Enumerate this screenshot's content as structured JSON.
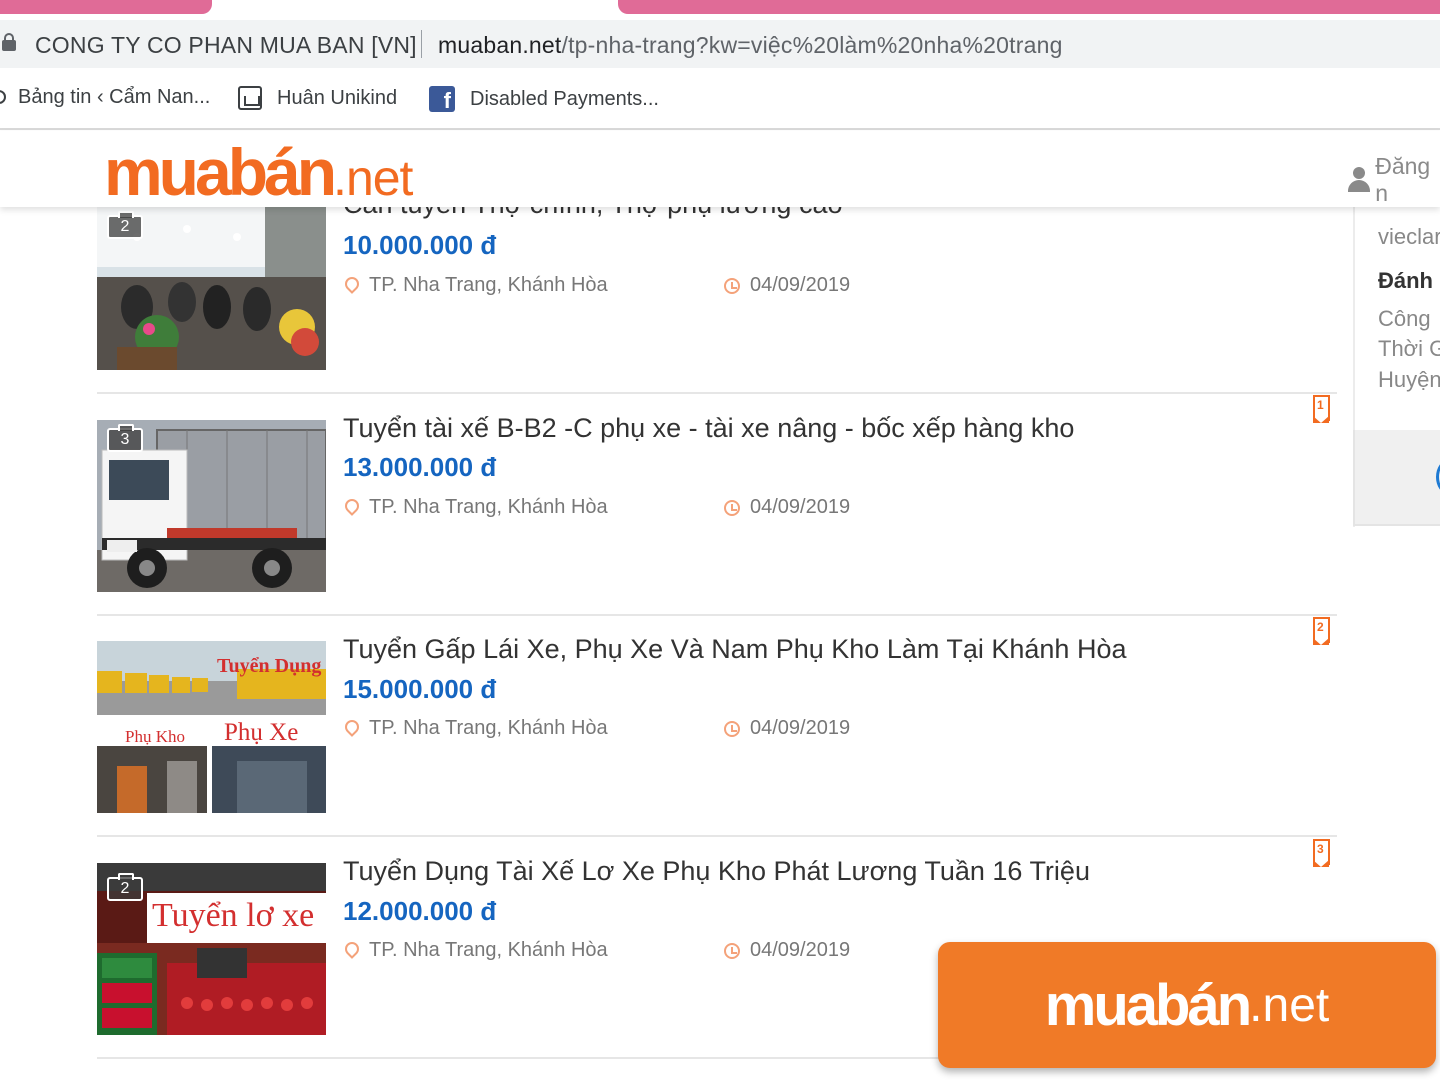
{
  "browser": {
    "site_identity": "CONG TY CO PHAN MUA BAN [VN]",
    "url_host": "muaban.net",
    "url_path": "/tp-nha-trang?kw=việc%20làm%20nha%20trang",
    "bookmarks": [
      {
        "label": "Bảng tin ‹ Cẩm Nan...",
        "icon": "circle-icon"
      },
      {
        "label": "Huân Unikind",
        "icon": "photo-icon"
      },
      {
        "label": "Disabled Payments...",
        "icon": "facebook-icon"
      }
    ]
  },
  "header": {
    "logo_brand": "muabán",
    "logo_tld": ".net",
    "login_label": "Đăng n"
  },
  "listings": [
    {
      "title": "Cần tuyển Thợ chính, Thợ phụ lương cao",
      "price": "10.000.000 đ",
      "location": "TP. Nha Trang, Khánh Hòa",
      "date": "04/09/2019",
      "photo_count": "2"
    },
    {
      "title": "Tuyển tài xế B-B2 -C phụ xe - tài xe nâng - bốc xếp hàng kho",
      "price": "13.000.000 đ",
      "location": "TP. Nha Trang, Khánh Hòa",
      "date": "04/09/2019",
      "photo_count": "3",
      "bookmark_num": "1"
    },
    {
      "title": "Tuyển Gấp Lái Xe, Phụ Xe Và Nam Phụ Kho Làm Tại Khánh Hòa",
      "price": "15.000.000 đ",
      "location": "TP. Nha Trang, Khánh Hòa",
      "date": "04/09/2019",
      "bookmark_num": "2",
      "thumb_text": {
        "top": "Tuyển Dụng",
        "left": "Phụ Kho",
        "right": "Phụ Xe"
      }
    },
    {
      "title": "Tuyển Dụng Tài Xế Lơ Xe Phụ Kho Phát Lương Tuần 16 Triệu",
      "price": "12.000.000 đ",
      "location": "TP. Nha Trang, Khánh Hòa",
      "date": "04/09/2019",
      "photo_count": "2",
      "bookmark_num": "3",
      "thumb_text": {
        "banner": "Tuyển lơ xe"
      }
    }
  ],
  "sidebar": {
    "line1": "vieclar",
    "line2": "Đánh",
    "line3": "Công",
    "line4": "Thời G",
    "line5": "Huyện"
  },
  "watermark": {
    "brand": "muabán",
    "tld": ".net"
  },
  "colors": {
    "brand_orange": "#f26b21",
    "price_blue": "#1565c0",
    "tab_pink": "#e06b97"
  }
}
